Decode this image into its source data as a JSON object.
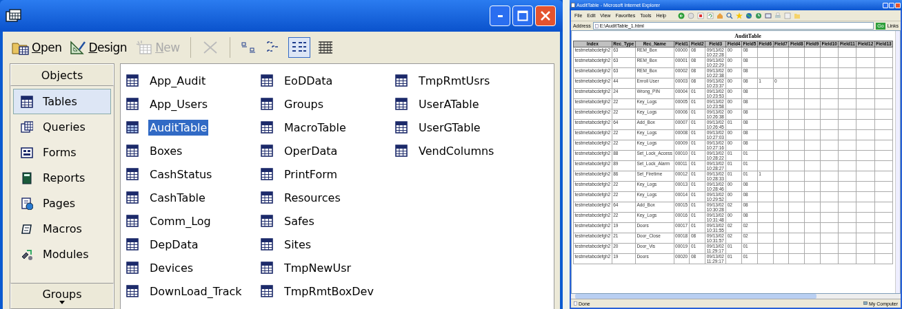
{
  "access_window": {
    "toolbar": [
      {
        "kind": "open",
        "label": "Open",
        "disabled": false,
        "selected": false
      },
      {
        "kind": "design",
        "label": "Design",
        "disabled": false,
        "selected": false
      },
      {
        "kind": "new",
        "label": "New",
        "disabled": true,
        "selected": false
      },
      {
        "kind": "delete",
        "disabled": true,
        "selected": false
      },
      {
        "kind": "large-icons",
        "disabled": false,
        "selected": false
      },
      {
        "kind": "small-icons",
        "disabled": false,
        "selected": false
      },
      {
        "kind": "list",
        "disabled": false,
        "selected": true
      },
      {
        "kind": "details",
        "disabled": false,
        "selected": false
      }
    ],
    "sidebar": {
      "header": "Objects",
      "items": [
        {
          "kind": "tables",
          "label": "Tables",
          "selected": true
        },
        {
          "kind": "queries",
          "label": "Queries",
          "selected": false
        },
        {
          "kind": "forms",
          "label": "Forms",
          "selected": false
        },
        {
          "kind": "reports",
          "label": "Reports",
          "selected": false
        },
        {
          "kind": "pages",
          "label": "Pages",
          "selected": false
        },
        {
          "kind": "macros",
          "label": "Macros",
          "selected": false
        },
        {
          "kind": "modules",
          "label": "Modules",
          "selected": false
        }
      ],
      "footer": "Groups"
    },
    "objects": [
      {
        "label": "App_Audit",
        "selected": false
      },
      {
        "label": "App_Users",
        "selected": false
      },
      {
        "label": "AuditTable",
        "selected": true
      },
      {
        "label": "Boxes",
        "selected": false
      },
      {
        "label": "CashStatus",
        "selected": false
      },
      {
        "label": "CashTable",
        "selected": false
      },
      {
        "label": "Comm_Log",
        "selected": false
      },
      {
        "label": "DepData",
        "selected": false
      },
      {
        "label": "Devices",
        "selected": false
      },
      {
        "label": "DownLoad_Track",
        "selected": false
      },
      {
        "label": "EoDData",
        "selected": false
      },
      {
        "label": "Groups",
        "selected": false
      },
      {
        "label": "MacroTable",
        "selected": false
      },
      {
        "label": "OperData",
        "selected": false
      },
      {
        "label": "PrintForm",
        "selected": false
      },
      {
        "label": "Resources",
        "selected": false
      },
      {
        "label": "Safes",
        "selected": false
      },
      {
        "label": "Sites",
        "selected": false
      },
      {
        "label": "TmpNewUsr",
        "selected": false
      },
      {
        "label": "TmpRmtBoxDev",
        "selected": false
      },
      {
        "label": "TmpRmtUsrs",
        "selected": false
      },
      {
        "label": "UserATable",
        "selected": false
      },
      {
        "label": "UserGTable",
        "selected": false
      },
      {
        "label": "VendColumns",
        "selected": false
      }
    ]
  },
  "browser_window": {
    "title": "AuditTable - Microsoft Internet Explorer",
    "menu": [
      "File",
      "Edit",
      "View",
      "Favorites",
      "Tools",
      "Help"
    ],
    "address_label": "Address",
    "address": "E:\\AuditTable_1.html",
    "go": "Go",
    "links": "Links",
    "table": {
      "caption": "AuditTable",
      "columns": [
        "Index",
        "Rec_Type",
        "Rec_Name",
        "Field1",
        "Field2",
        "Field3",
        "Field4",
        "Field5",
        "Field6",
        "Field7",
        "Field8",
        "Field9",
        "Field10",
        "Field11",
        "Field12",
        "Field13"
      ],
      "rows": [
        [
          "testmetabcdefgh2",
          "63",
          "REM_Box",
          "00000",
          "08",
          "09/13/02 10:22:28",
          "00",
          "08",
          "",
          ""
        ],
        [
          "testmetabcdefgh2",
          "63",
          "REM_Box",
          "00001",
          "08",
          "09/13/02 10:22:29",
          "00",
          "08",
          "",
          ""
        ],
        [
          "testmetabcdefgh2",
          "63",
          "REM_Box",
          "00002",
          "08",
          "09/13/02 10:22:38",
          "00",
          "08",
          "",
          ""
        ],
        [
          "testmetabcdefgh2",
          "44",
          "Enroll User",
          "00003",
          "08",
          "09/13/02 10:23:37",
          "00",
          "08",
          "1",
          "0"
        ],
        [
          "testmetabcdefgh2",
          "24",
          "Wrong_PIN",
          "00004",
          "01",
          "09/13/02 10:23:53",
          "00",
          "08",
          "",
          ""
        ],
        [
          "testmetabcdefgh2",
          "22",
          "Key_Logs",
          "00005",
          "01",
          "09/13/02 10:23:58",
          "00",
          "08",
          "",
          ""
        ],
        [
          "testmetabcdefgh2",
          "22",
          "Key_Logs",
          "00006",
          "01",
          "09/13/02 10:26:38",
          "00",
          "08",
          "",
          ""
        ],
        [
          "testmetabcdefgh2",
          "64",
          "Add_Box",
          "00007",
          "01",
          "09/13/02 10:26:45",
          "01",
          "08",
          "",
          ""
        ],
        [
          "testmetabcdefgh2",
          "22",
          "Key_Logs",
          "00008",
          "01",
          "09/13/02 10:27:03",
          "00",
          "08",
          "",
          ""
        ],
        [
          "testmetabcdefgh2",
          "22",
          "Key_Logs",
          "00009",
          "01",
          "09/13/02 10:27:16",
          "00",
          "08",
          "",
          ""
        ],
        [
          "testmetabcdefgh2",
          "88",
          "Set_Lock_Access",
          "00010",
          "01",
          "09/13/02 10:28:22",
          "01",
          "01",
          "",
          ""
        ],
        [
          "testmetabcdefgh2",
          "89",
          "Set_Lock_Alarm",
          "00011",
          "01",
          "09/13/02 10:28:27",
          "01",
          "01",
          "",
          ""
        ],
        [
          "testmetabcdefgh2",
          "86",
          "Set_Firetime",
          "00012",
          "01",
          "09/13/02 10:28:33",
          "01",
          "01",
          "1",
          ""
        ],
        [
          "testmetabcdefgh2",
          "22",
          "Key_Logs",
          "00013",
          "01",
          "09/13/02 10:28:46",
          "00",
          "08",
          "",
          ""
        ],
        [
          "testmetabcdefgh2",
          "22",
          "Key_Logs",
          "00014",
          "01",
          "09/13/02 10:29:52",
          "00",
          "08",
          "",
          ""
        ],
        [
          "testmetabcdefgh2",
          "64",
          "Add_Box",
          "00015",
          "01",
          "09/13/02 10:30:28",
          "02",
          "08",
          "",
          ""
        ],
        [
          "testmetabcdefgh2",
          "22",
          "Key_Logs",
          "00016",
          "01",
          "09/13/02 10:31:48",
          "00",
          "08",
          "",
          ""
        ],
        [
          "testmetabcdefgh2",
          "19",
          "Doors",
          "00017",
          "01",
          "09/13/02 10:31:55",
          "02",
          "02",
          "",
          ""
        ],
        [
          "testmetabcdefgh2",
          "21",
          "Door_Close",
          "00018",
          "08",
          "09/13/02 10:31:57",
          "02",
          "02",
          "",
          ""
        ],
        [
          "testmetabcdefgh2",
          "20",
          "Door_Vis",
          "00019",
          "01",
          "09/13/02 11:29:17",
          "01",
          "01",
          "",
          ""
        ],
        [
          "testmetabcdefgh2",
          "19",
          "Doors",
          "00020",
          "08",
          "09/13/02 11:29:17",
          "01",
          "01",
          "",
          ""
        ]
      ]
    },
    "status": {
      "left": "Done",
      "right": "My Computer"
    }
  }
}
